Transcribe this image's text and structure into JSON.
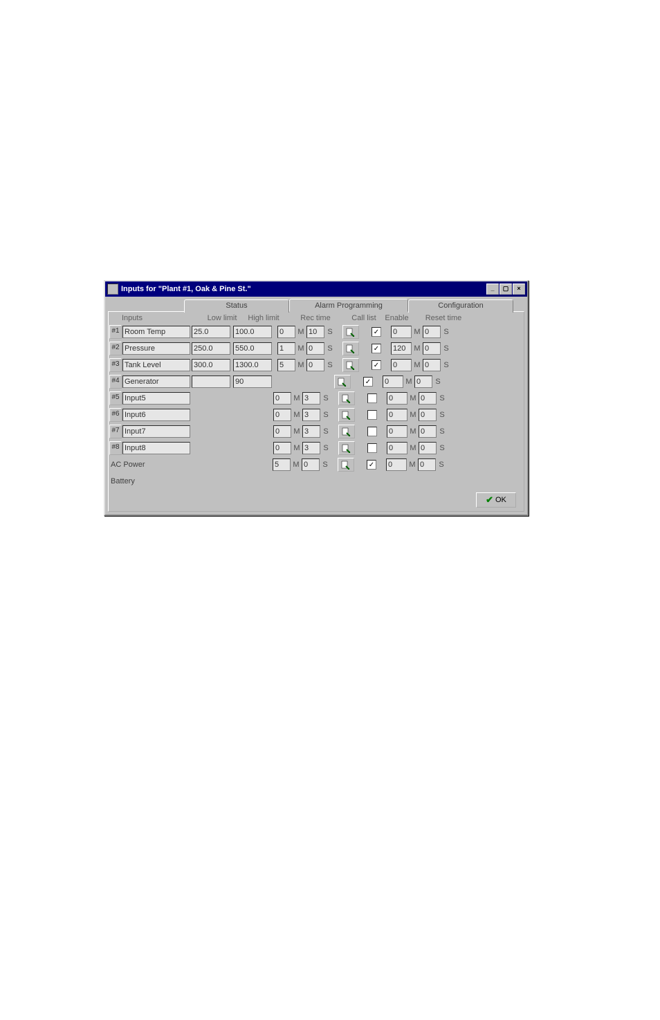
{
  "window": {
    "title": "Inputs for \"Plant #1, Oak & Pine St.\"",
    "minimize": "_",
    "maximize": "▢",
    "close": "×"
  },
  "tabs": {
    "status": "Status",
    "alarm": "Alarm Programming",
    "config": "Configuration"
  },
  "headers": {
    "inputs": "Inputs",
    "lowlimit": "Low limit",
    "highlimit": "High limit",
    "rectime": "Rec time",
    "calllist": "Call list",
    "enable": "Enable",
    "resettime": "Reset time"
  },
  "units": {
    "m": "M",
    "s": "S"
  },
  "ok": "OK",
  "extra": {
    "acpower": "AC Power",
    "battery": "Battery"
  },
  "rows": [
    {
      "num": "#1",
      "name": "Room Temp",
      "low": "25.0",
      "high": "100.0",
      "rt_m": "0",
      "rt_s": "10",
      "enable": true,
      "rs_m": "0",
      "rs_s": "0"
    },
    {
      "num": "#2",
      "name": "Pressure",
      "low": "250.0",
      "high": "550.0",
      "rt_m": "1",
      "rt_s": "0",
      "enable": true,
      "rs_m": "120",
      "rs_s": "0"
    },
    {
      "num": "#3",
      "name": "Tank Level",
      "low": "300.0",
      "high": "1300.0",
      "rt_m": "5",
      "rt_s": "0",
      "enable": true,
      "rs_m": "0",
      "rs_s": "0"
    },
    {
      "num": "#4",
      "name": "Generator",
      "low": "",
      "high": "90",
      "rt_m": "",
      "rt_s": "",
      "enable": true,
      "rs_m": "0",
      "rs_s": "0"
    },
    {
      "num": "#5",
      "name": "Input5",
      "low": "",
      "high": "",
      "rt_m": "0",
      "rt_s": "3",
      "enable": false,
      "rs_m": "0",
      "rs_s": "0"
    },
    {
      "num": "#6",
      "name": "Input6",
      "low": "",
      "high": "",
      "rt_m": "0",
      "rt_s": "3",
      "enable": false,
      "rs_m": "0",
      "rs_s": "0"
    },
    {
      "num": "#7",
      "name": "Input7",
      "low": "",
      "high": "",
      "rt_m": "0",
      "rt_s": "3",
      "enable": false,
      "rs_m": "0",
      "rs_s": "0"
    },
    {
      "num": "#8",
      "name": "Input8",
      "low": "",
      "high": "",
      "rt_m": "0",
      "rt_s": "3",
      "enable": false,
      "rs_m": "0",
      "rs_s": "0"
    }
  ],
  "acpower_row": {
    "rt_m": "5",
    "rt_s": "0",
    "enable": true,
    "rs_m": "0",
    "rs_s": "0"
  }
}
